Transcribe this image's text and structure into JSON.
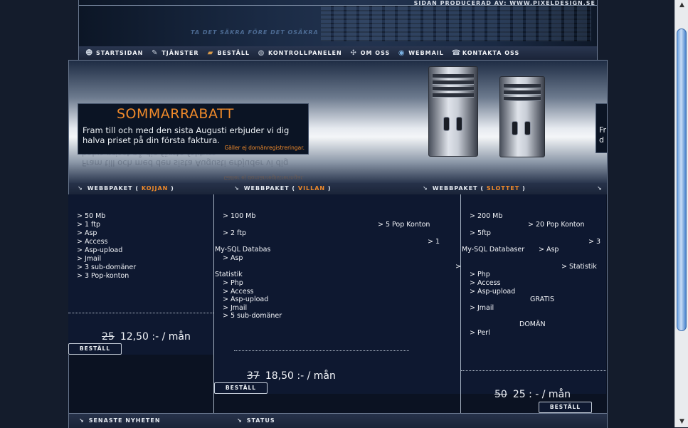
{
  "header": {
    "credit": "SIDAN PRODUCERAD AV: WWW.PIXELDESIGN.SE",
    "slogan": "TA DET SÄKRA FÖRE DET OSÄKRA"
  },
  "nav": {
    "items": [
      {
        "label": "STARTSIDAN",
        "icon": "person-icon"
      },
      {
        "label": "TJÄNSTER",
        "icon": "tools-icon"
      },
      {
        "label": "BESTÄLL",
        "icon": "box-icon"
      },
      {
        "label": "KONTROLLPANELEN",
        "icon": "lock-icon"
      },
      {
        "label": "OM OSS",
        "icon": "grid-icon"
      },
      {
        "label": "WEBMAIL",
        "icon": "globe-icon"
      },
      {
        "label": "KONTAKTA OSS",
        "icon": "phone-icon"
      }
    ]
  },
  "banner": {
    "promo_title": "SOMMARRABATT",
    "promo_text": "Fram till och med den sista Augusti erbjuder vi dig halva priset på din första faktura.",
    "promo_note": "Gäller ej domänregistreringar.",
    "promo2_text": "Fr d"
  },
  "packages": {
    "header_prefix": "WEBBPAKET",
    "col1": {
      "name": "KOJJAN",
      "features": [
        "> 50 Mb",
        "> 1 ftp",
        "> Asp",
        "> Access",
        "> Asp-upload",
        "> Jmail",
        "> 3 sub-domäner",
        "> 3 Pop-konton"
      ],
      "old_price": "25",
      "price": "12,50 :- / mån",
      "button": "BESTÄLL"
    },
    "col2": {
      "name": "VILLAN",
      "f_100mb": "> 100 Mb",
      "f_pop": "> 5 Pop Konton",
      "f_1": "> 1",
      "f_ftp": "> 2 ftp",
      "f_mysql": "My-SQL Databas",
      "f_asp": "> Asp",
      "f_statistik": "Statistik",
      "f_php": "> Php",
      "f_access": "> Access",
      "f_aspupload": "> Asp-upload",
      "f_jmail": "> Jmail",
      "f_sub": "> 5 sub-domäner",
      "old_price": "37",
      "price": "18,50 :- / mån",
      "button": "BESTÄLL"
    },
    "col3": {
      "name": "SLOTTET",
      "f_200mb": "> 200 Mb",
      "f_pop": "> 20 Pop Konton",
      "f_ftp": "> 5ftp",
      "f_3": "> 3",
      "f_mysql": "My-SQL Databaser",
      "f_asp": "> Asp",
      "f_statistik": "> Statistik",
      "f_php": "> Php",
      "f_access": "> Access",
      "f_aspupload": "> Asp-upload",
      "f_gratis": "GRATIS",
      "f_jmail": "> Jmail",
      "f_doman": "DOMÄN",
      "f_perl": "> Perl",
      "old_price": "50",
      "price": "25 : - / mån",
      "button": "BESTÄLL"
    },
    "col4_arrow": ">"
  },
  "bottom": {
    "news": "SENASTE NYHETEN",
    "status": "STATUS"
  },
  "scrollbar": {
    "up": "▲",
    "down": "▼"
  }
}
